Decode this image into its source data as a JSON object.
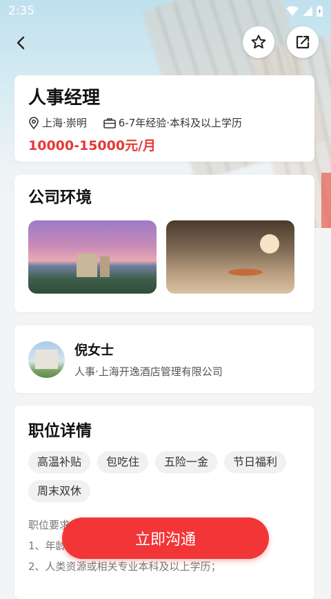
{
  "status": {
    "time": "2:35",
    "icons": [
      "wifi-icon",
      "signal-icon",
      "battery-icon"
    ]
  },
  "nav": {
    "back_icon": "back-arrow-icon",
    "favorite_icon": "star-icon",
    "share_icon": "share-icon"
  },
  "job": {
    "title": "人事经理",
    "location": "上海·崇明",
    "requirement": "6-7年经验·本科及以上学历",
    "salary": "10000-15000元/月",
    "salary_color": "#e53935"
  },
  "environment": {
    "title": "公司环境"
  },
  "contact": {
    "name": "倪女士",
    "subtitle": "人事·上海开逸酒店管理有限公司"
  },
  "details": {
    "title": "职位详情",
    "tags": [
      "高温补贴",
      "包吃住",
      "五险一金",
      "节日福利",
      "周末双休"
    ],
    "req_heading": "职位要求：",
    "req_line1": "1、年龄",
    "req_line2": "2、人类资源或相关专业本科及以上学历；"
  },
  "cta": {
    "label": "立即沟通",
    "color": "#f23537"
  }
}
